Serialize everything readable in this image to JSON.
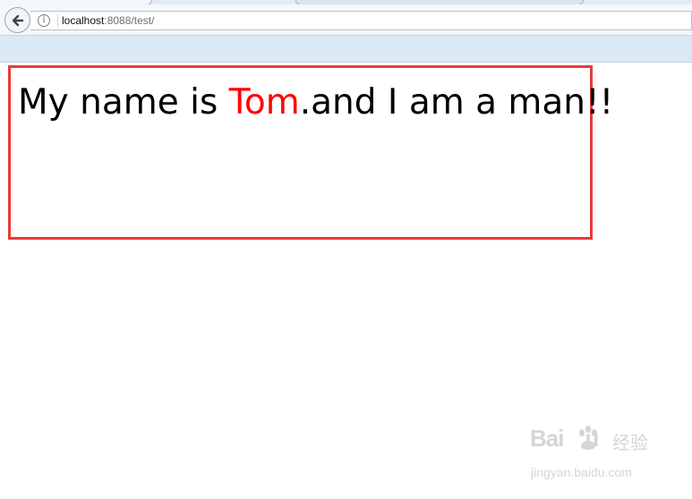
{
  "browser": {
    "address": {
      "host": "localhost",
      "rest": ":8088/test/"
    },
    "back_icon": "back-arrow-icon",
    "info_icon": "info-icon",
    "info_glyph": "i"
  },
  "page": {
    "sentence_before": "My name is ",
    "name": "Tom",
    "sentence_after": ".and I am a man!!",
    "name_color": "#ff0000",
    "frame_color": "#ec3a3a"
  },
  "watermark": {
    "logo_text": "Bai",
    "logo_text_2": "u",
    "chinese": "经验",
    "url": "jingyan.baidu.com"
  }
}
